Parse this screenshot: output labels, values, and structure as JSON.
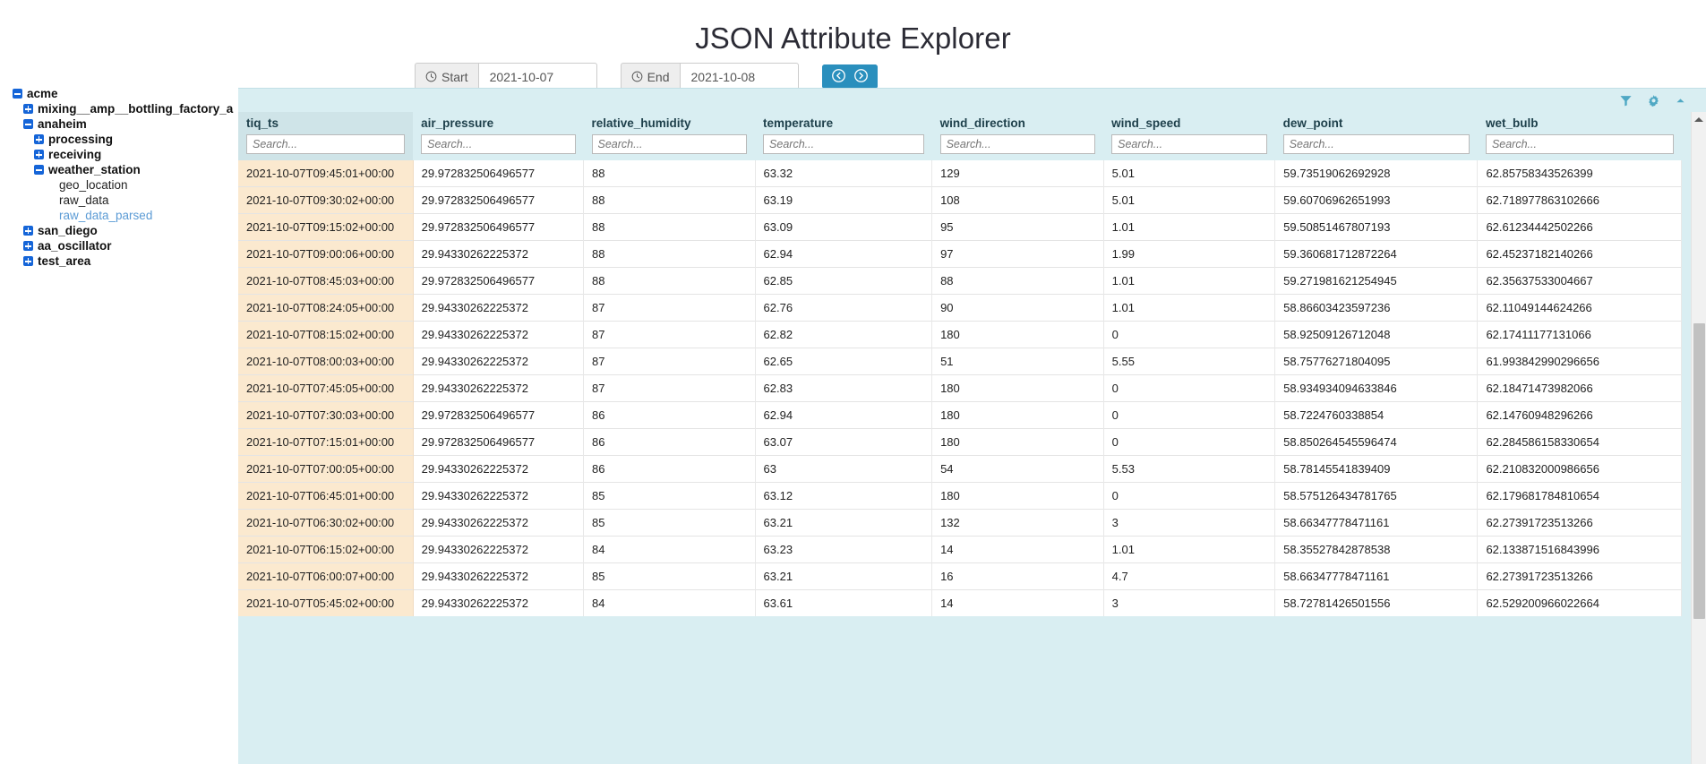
{
  "page": {
    "title": "JSON Attribute Explorer"
  },
  "toolbar": {
    "start": {
      "label": "Start",
      "value": "2021-10-07",
      "icon": "clock-icon"
    },
    "end": {
      "label": "End",
      "value": "2021-10-08",
      "icon": "clock-icon"
    },
    "nav": {
      "prev_icon": "arrow-circle-left-icon",
      "next_icon": "arrow-circle-right-icon"
    }
  },
  "sidebar": {
    "items": [
      {
        "label": "acme",
        "depth": 0,
        "state": "expanded",
        "selected": false
      },
      {
        "label": "mixing__amp__bottling_factory_a",
        "depth": 1,
        "state": "collapsed",
        "selected": false
      },
      {
        "label": "anaheim",
        "depth": 1,
        "state": "expanded",
        "selected": false
      },
      {
        "label": "processing",
        "depth": 2,
        "state": "collapsed",
        "selected": false
      },
      {
        "label": "receiving",
        "depth": 2,
        "state": "collapsed",
        "selected": false
      },
      {
        "label": "weather_station",
        "depth": 2,
        "state": "expanded",
        "selected": false
      },
      {
        "label": "geo_location",
        "depth": 3,
        "state": "leaf",
        "selected": false
      },
      {
        "label": "raw_data",
        "depth": 3,
        "state": "leaf",
        "selected": false
      },
      {
        "label": "raw_data_parsed",
        "depth": 3,
        "state": "leaf",
        "selected": true
      },
      {
        "label": "san_diego",
        "depth": 1,
        "state": "collapsed",
        "selected": false
      },
      {
        "label": "aa_oscillator",
        "depth": 1,
        "state": "collapsed",
        "selected": false
      },
      {
        "label": "test_area",
        "depth": 1,
        "state": "collapsed",
        "selected": false
      }
    ]
  },
  "grid": {
    "toolbar_icons": [
      "filter-icon",
      "gear-icon",
      "collapse-icon"
    ],
    "search_placeholder": "Search...",
    "sorted_column": "tiq_ts",
    "columns": [
      "tiq_ts",
      "air_pressure",
      "relative_humidity",
      "temperature",
      "wind_direction",
      "wind_speed",
      "dew_point",
      "wet_bulb"
    ],
    "rows": [
      [
        "2021-10-07T09:45:01+00:00",
        "29.972832506496577",
        "88",
        "63.32",
        "129",
        "5.01",
        "59.73519062692928",
        "62.85758343526399"
      ],
      [
        "2021-10-07T09:30:02+00:00",
        "29.972832506496577",
        "88",
        "63.19",
        "108",
        "5.01",
        "59.60706962651993",
        "62.718977863102666"
      ],
      [
        "2021-10-07T09:15:02+00:00",
        "29.972832506496577",
        "88",
        "63.09",
        "95",
        "1.01",
        "59.50851467807193",
        "62.61234442502266"
      ],
      [
        "2021-10-07T09:00:06+00:00",
        "29.94330262225372",
        "88",
        "62.94",
        "97",
        "1.99",
        "59.360681712872264",
        "62.45237182140266"
      ],
      [
        "2021-10-07T08:45:03+00:00",
        "29.972832506496577",
        "88",
        "62.85",
        "88",
        "1.01",
        "59.271981621254945",
        "62.35637533004667"
      ],
      [
        "2021-10-07T08:24:05+00:00",
        "29.94330262225372",
        "87",
        "62.76",
        "90",
        "1.01",
        "58.86603423597236",
        "62.11049144624266"
      ],
      [
        "2021-10-07T08:15:02+00:00",
        "29.94330262225372",
        "87",
        "62.82",
        "180",
        "0",
        "58.92509126712048",
        "62.17411177131066"
      ],
      [
        "2021-10-07T08:00:03+00:00",
        "29.94330262225372",
        "87",
        "62.65",
        "51",
        "5.55",
        "58.75776271804095",
        "61.993842990296656"
      ],
      [
        "2021-10-07T07:45:05+00:00",
        "29.94330262225372",
        "87",
        "62.83",
        "180",
        "0",
        "58.934934094633846",
        "62.18471473982066"
      ],
      [
        "2021-10-07T07:30:03+00:00",
        "29.972832506496577",
        "86",
        "62.94",
        "180",
        "0",
        "58.7224760338854",
        "62.14760948296266"
      ],
      [
        "2021-10-07T07:15:01+00:00",
        "29.972832506496577",
        "86",
        "63.07",
        "180",
        "0",
        "58.850264545596474",
        "62.284586158330654"
      ],
      [
        "2021-10-07T07:00:05+00:00",
        "29.94330262225372",
        "86",
        "63",
        "54",
        "5.53",
        "58.78145541839409",
        "62.210832000986656"
      ],
      [
        "2021-10-07T06:45:01+00:00",
        "29.94330262225372",
        "85",
        "63.12",
        "180",
        "0",
        "58.575126434781765",
        "62.179681784810654"
      ],
      [
        "2021-10-07T06:30:02+00:00",
        "29.94330262225372",
        "85",
        "63.21",
        "132",
        "3",
        "58.66347778471161",
        "62.27391723513266"
      ],
      [
        "2021-10-07T06:15:02+00:00",
        "29.94330262225372",
        "84",
        "63.23",
        "14",
        "1.01",
        "58.35527842878538",
        "62.133871516843996"
      ],
      [
        "2021-10-07T06:00:07+00:00",
        "29.94330262225372",
        "85",
        "63.21",
        "16",
        "4.7",
        "58.66347778471161",
        "62.27391723513266"
      ],
      [
        "2021-10-07T05:45:02+00:00",
        "29.94330262225372",
        "84",
        "63.61",
        "14",
        "3",
        "58.72781426501556",
        "62.529200966022664"
      ]
    ]
  },
  "colors": {
    "accent": "#2a8fbd",
    "panel_bg": "#d9eef2",
    "sorted_cell_bg": "#fbe9cf",
    "tree_toggle": "#1565d8",
    "link": "#5b9bd5"
  }
}
